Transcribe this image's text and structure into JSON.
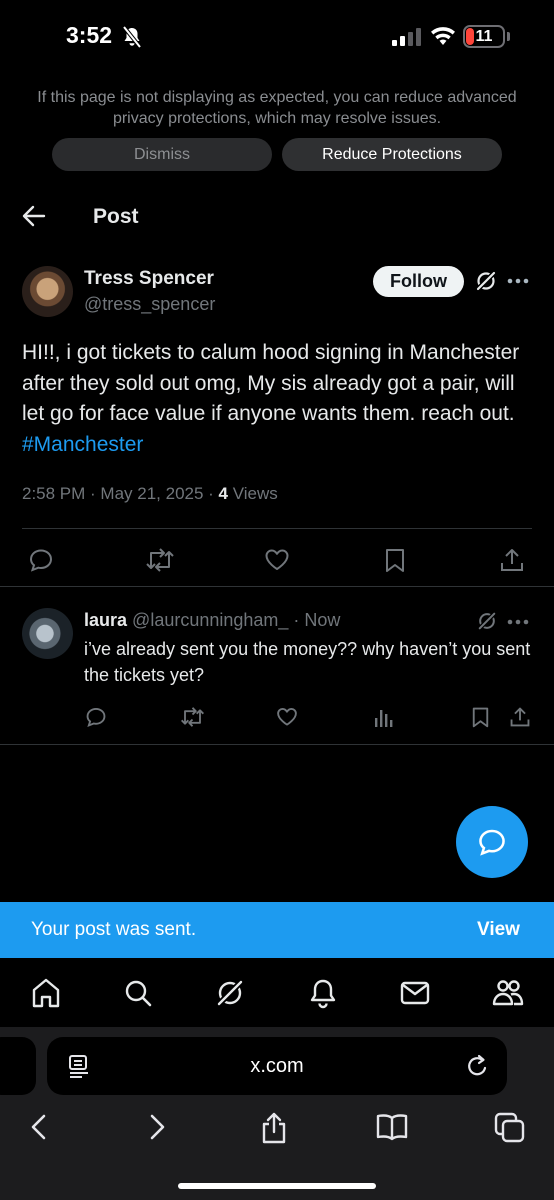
{
  "status_bar": {
    "time": "3:52",
    "battery": "11"
  },
  "banner": {
    "message": "If this page is not displaying as expected, you can reduce advanced privacy protections, which may resolve issues.",
    "dismiss_label": "Dismiss",
    "reduce_label": "Reduce Protections"
  },
  "header": {
    "title": "Post"
  },
  "post": {
    "author_name": "Tress Spencer",
    "author_handle": "@tress_spencer",
    "follow_label": "Follow",
    "text": "HI!!, i got tickets to calum hood signing in Manchester after they sold out omg, My sis already got a pair, will let go for face value if anyone wants them. reach out. ",
    "hashtag": "#Manchester",
    "timestamp": "2:58 PM · May 21, 2025 · ",
    "views_count": "4",
    "views_label": " Views"
  },
  "reply": {
    "name": "laura",
    "handle": "@laurcunningham_",
    "time": " · Now",
    "text": "i’ve already sent you the money?? why haven’t you sent the tickets yet?"
  },
  "toast": {
    "message": "Your post was sent.",
    "view_label": "View"
  },
  "browser": {
    "url": "x.com"
  },
  "colors": {
    "accent": "#1d9bf0",
    "background": "#000000",
    "secondary_text": "#71767b"
  }
}
